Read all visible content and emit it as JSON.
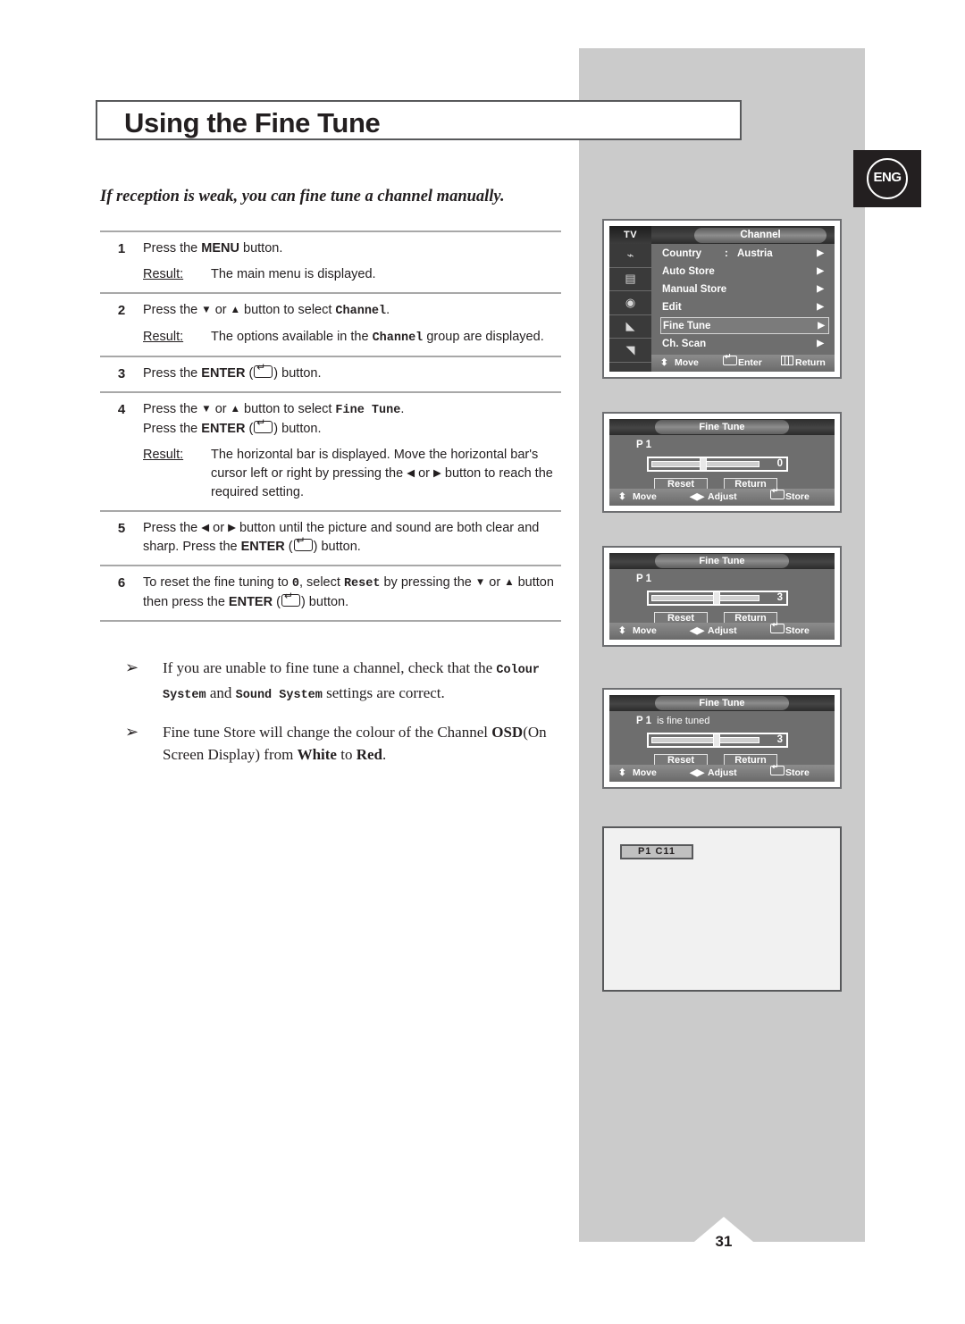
{
  "page": {
    "number": "31",
    "language_badge": "ENG",
    "title": "Using the Fine Tune",
    "intro": "If reception is weak, you can fine tune a channel manually."
  },
  "steps": [
    {
      "number": "1",
      "instruction_pre": "Press the ",
      "instruction_bold": "MENU",
      "instruction_post": " button.",
      "result_label": "Result:",
      "result_text": "The main menu is displayed."
    },
    {
      "number": "2",
      "instruction_pre": "Press the ",
      "arrow_down": "▼",
      "or": " or ",
      "arrow_up": "▲",
      "instruction_mid": " button to select ",
      "target": "Channel",
      "instruction_post": ".",
      "result_label": "Result:",
      "result_pre": "The options available in the ",
      "result_target": "Channel",
      "result_post": " group are displayed."
    },
    {
      "number": "3",
      "instruction_pre": "Press the ",
      "instruction_bold": "ENTER",
      "instruction_post": " button."
    },
    {
      "number": "4",
      "line1_pre": "Press the ",
      "arrow_down": "▼",
      "or": " or ",
      "arrow_up": "▲",
      "line1_mid": " button to select ",
      "line1_target": "Fine Tune",
      "line1_post": ".",
      "line2_pre": "Press the ",
      "line2_bold": "ENTER",
      "line2_post": " button.",
      "result_label": "Result:",
      "result_text_a": "The horizontal bar is displayed. Move the horizontal bar's cursor left or right by pressing the ",
      "arrow_left": "◀",
      "arrow_right": "▶",
      "result_text_b": " button to reach the required setting."
    },
    {
      "number": "5",
      "text_a": "Press the ",
      "arrow_left": "◀",
      "or": " or ",
      "arrow_right": "▶",
      "text_b": " button until the picture and sound are both clear and sharp. Press the ",
      "bold": "ENTER",
      "text_c": " button."
    },
    {
      "number": "6",
      "text_a": "To reset the fine tuning to ",
      "zero": "0",
      "text_b": ", select ",
      "reset_word": "Reset",
      "text_c": " by pressing the ",
      "arrow_down": "▼",
      "or": " or ",
      "arrow_up": "▲",
      "text_d": " button then press the ",
      "bold": "ENTER",
      "text_e": " button."
    }
  ],
  "notes": [
    {
      "bullet": "➢",
      "pre": "If you are unable to fine tune a channel, check that the ",
      "mono1": "Colour System",
      "mid": " and ",
      "mono2": "Sound System",
      "post": " settings are correct."
    },
    {
      "bullet": "➢",
      "pre": "Fine tune Store will change the colour of the Channel ",
      "bold1": "OSD",
      "mid": "(On Screen Display) from ",
      "bold2": "White",
      "mid2": " to ",
      "bold3": "Red",
      "post": "."
    }
  ],
  "channel_menu": {
    "tv_label": "TV",
    "title": "Channel",
    "sidebar_icons": [
      "input-icon",
      "picture-icon",
      "sound-icon",
      "feature-icon",
      "setup-icon"
    ],
    "rows": [
      {
        "label": "Country",
        "colon": ":",
        "value": "Austria",
        "chevron": "▶",
        "selected": false
      },
      {
        "label": "Auto Store",
        "colon": "",
        "value": "",
        "chevron": "▶",
        "selected": false
      },
      {
        "label": "Manual Store",
        "colon": "",
        "value": "",
        "chevron": "▶",
        "selected": false
      },
      {
        "label": "Edit",
        "colon": "",
        "value": "",
        "chevron": "▶",
        "selected": false
      },
      {
        "label": "Fine Tune",
        "colon": "",
        "value": "",
        "chevron": "▶",
        "selected": true
      },
      {
        "label": "Ch. Scan",
        "colon": "",
        "value": "",
        "chevron": "▶",
        "selected": false
      }
    ],
    "footer": {
      "move_arrows": "⬍",
      "move": "Move",
      "enter": "Enter",
      "return": "Return"
    }
  },
  "fine_tune_panels": [
    {
      "title": "Fine Tune",
      "channel_label": "P 1",
      "status": "",
      "value": "0",
      "thumb_percent": 50,
      "reset_label": "Reset",
      "return_label": "Return",
      "footer": {
        "move_arrows": "⬍",
        "move": "Move",
        "adjust_arrows": "◀▶",
        "adjust": "Adjust",
        "store": "Store"
      }
    },
    {
      "title": "Fine Tune",
      "channel_label": "P 1",
      "status": "",
      "value": "3",
      "thumb_percent": 62,
      "reset_label": "Reset",
      "return_label": "Return",
      "footer": {
        "move_arrows": "⬍",
        "move": "Move",
        "adjust_arrows": "◀▶",
        "adjust": "Adjust",
        "store": "Store"
      }
    },
    {
      "title": "Fine Tune",
      "channel_label": "P 1",
      "status": "is fine tuned",
      "value": "3",
      "thumb_percent": 62,
      "reset_label": "Reset",
      "return_label": "Return",
      "footer": {
        "move_arrows": "⬍",
        "move": "Move",
        "adjust_arrows": "◀▶",
        "adjust": "Adjust",
        "store": "Store"
      }
    }
  ],
  "tv_screen": {
    "channel_chip": "P1  C11"
  },
  "colors": {
    "band_gray": "#cbcbcb",
    "ink": "#231f20",
    "osd_gray": "#6e6e6e",
    "rule": "#a8a8a8"
  }
}
